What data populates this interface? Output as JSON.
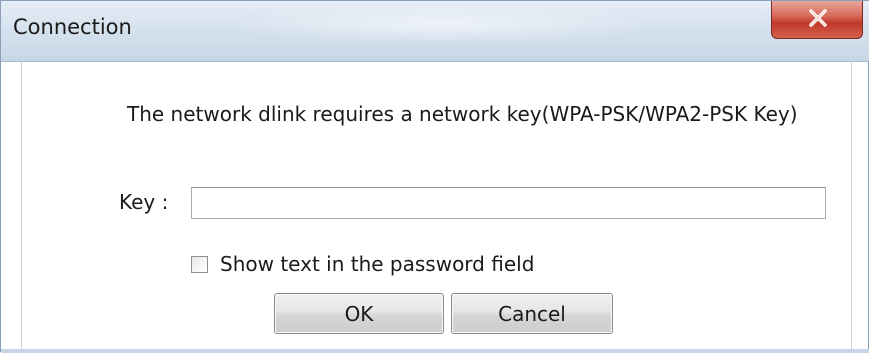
{
  "window": {
    "title": "Connection"
  },
  "message": "The network dlink requires a network key(WPA-PSK/WPA2-PSK Key)",
  "key": {
    "label": "Key :",
    "value": "",
    "placeholder": ""
  },
  "show_password": {
    "label": "Show text in the password field",
    "checked": false
  },
  "buttons": {
    "ok": "OK",
    "cancel": "Cancel"
  },
  "icons": {
    "close": "close-icon"
  },
  "colors": {
    "close_button": "#c0392b",
    "titlebar": "#d6e2ee"
  }
}
